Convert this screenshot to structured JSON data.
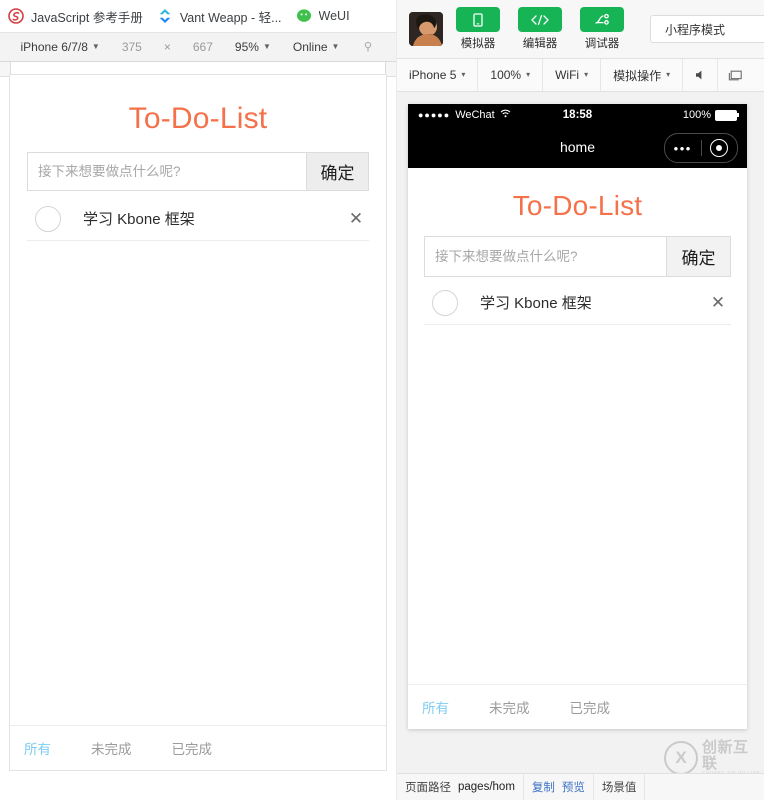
{
  "browser": {
    "tabs": [
      {
        "title": "JavaScript 参考手册",
        "icon": "runoob-favicon"
      },
      {
        "title": "Vant Weapp - 轻...",
        "icon": "vant-favicon"
      },
      {
        "title": "WeUI",
        "icon": "wechat-favicon"
      }
    ],
    "device_toolbar": {
      "device": "iPhone 6/7/8",
      "width": "375",
      "times": "×",
      "height": "667",
      "zoom": "95%",
      "throttling": "Online"
    }
  },
  "page": {
    "title": "To-Do-List",
    "title_color": "#f4714a",
    "input_placeholder": "接下来想要做点什么呢?",
    "input_value": "",
    "confirm_label": "确定",
    "todos": [
      {
        "text": "学习 Kbone 框架",
        "done": false,
        "delete_label": "✕"
      }
    ],
    "tabs": [
      {
        "label": "所有",
        "active": true
      },
      {
        "label": "未完成",
        "active": false
      },
      {
        "label": "已完成",
        "active": false
      }
    ],
    "active_tab_color": "#7ecdf0"
  },
  "devtools": {
    "tools": [
      {
        "label": "模拟器",
        "icon": "phone-icon"
      },
      {
        "label": "编辑器",
        "icon": "code-icon"
      },
      {
        "label": "调试器",
        "icon": "debug-icon"
      }
    ],
    "tool_color": "#16b454",
    "mode_select": "小程序模式",
    "toolbar": {
      "device": "iPhone 5",
      "scale": "100%",
      "network": "WiFi",
      "simulate": "模拟操作",
      "mute_icon": "speaker-icon",
      "window_icon": "window-icon"
    },
    "simulator": {
      "statusbar": {
        "dots": "●●●●●",
        "carrier": "WeChat",
        "wifi_icon": "wifi-icon",
        "time": "18:58",
        "battery_percent": "100%"
      },
      "navbar": {
        "title": "home",
        "menu_icon": "more-dots-icon",
        "target_icon": "target-icon"
      }
    },
    "statusbar_bottom": [
      {
        "label": "页面路径",
        "value": "pages/hom"
      },
      {
        "label": "复制",
        "value": "预览"
      },
      {
        "label": "场景值",
        "value": ""
      }
    ]
  },
  "watermark": {
    "mark": "X",
    "name": "创新互联",
    "subtitle": "CHUANG XIN HU LIAN"
  }
}
